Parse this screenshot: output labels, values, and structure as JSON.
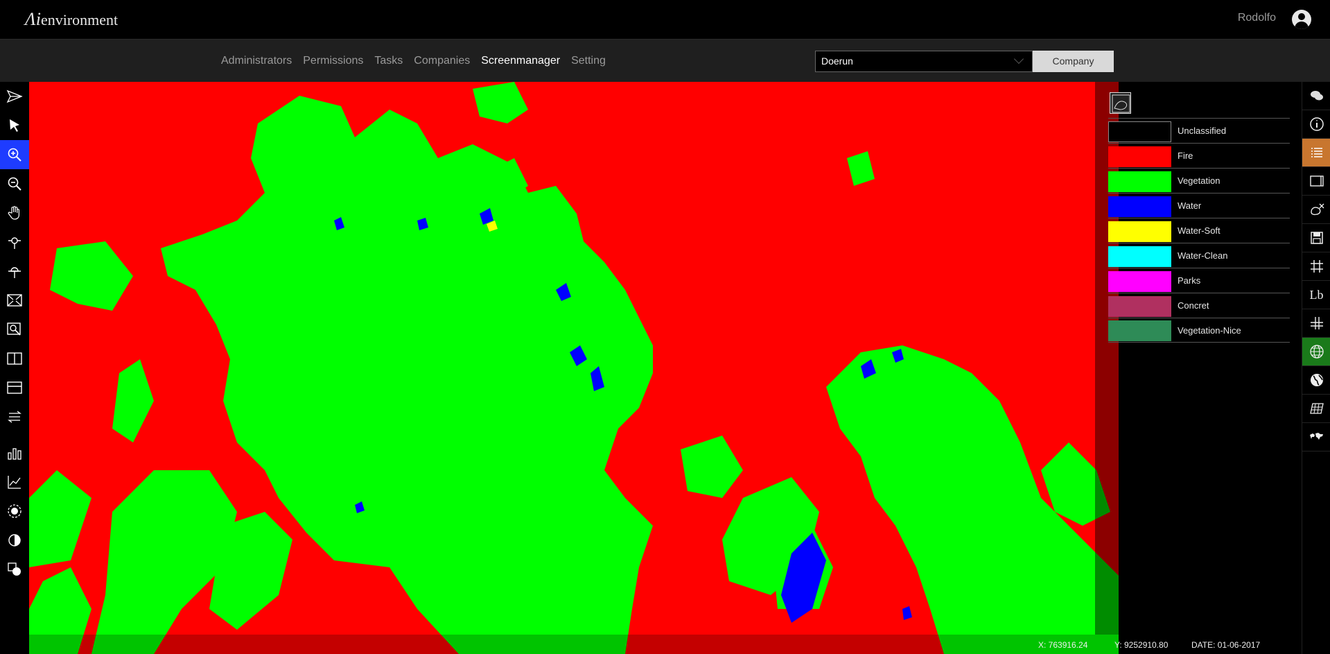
{
  "header": {
    "logo_ai": "Λi",
    "logo_text": "environment",
    "user_name": "Rodolfo"
  },
  "nav": {
    "items": [
      "Administrators",
      "Permissions",
      "Tasks",
      "Companies",
      "Screenmanager",
      "Setting"
    ],
    "active": "Screenmanager"
  },
  "company": {
    "selected": "Doerun",
    "button_label": "Company"
  },
  "left_toolbar": [
    {
      "name": "send-icon"
    },
    {
      "name": "pointer-icon"
    },
    {
      "name": "zoom-in-icon",
      "active": true
    },
    {
      "name": "zoom-out-icon"
    },
    {
      "name": "pan-hand-icon"
    },
    {
      "name": "pin-add-icon"
    },
    {
      "name": "pin-remove-icon"
    },
    {
      "name": "fit-extent-icon"
    },
    {
      "name": "zoom-window-icon"
    },
    {
      "name": "split-vertical-icon"
    },
    {
      "name": "split-horizontal-icon"
    },
    {
      "name": "swipe-icon"
    },
    {
      "name": "bar-chart-icon"
    },
    {
      "name": "line-chart-icon"
    },
    {
      "name": "brightness-icon"
    },
    {
      "name": "contrast-icon"
    },
    {
      "name": "layers-color-icon"
    }
  ],
  "right_toolbar": [
    {
      "name": "chat-icon"
    },
    {
      "name": "info-icon"
    },
    {
      "name": "legend-list-icon",
      "state": "orange"
    },
    {
      "name": "panel-icon"
    },
    {
      "name": "clear-layer-icon"
    },
    {
      "name": "save-icon"
    },
    {
      "name": "grid-icon"
    },
    {
      "name": "label-icon",
      "text": "Lb"
    },
    {
      "name": "graticule-icon"
    },
    {
      "name": "globe-grid-icon",
      "state": "green"
    },
    {
      "name": "globe-icon"
    },
    {
      "name": "map-tiles-icon"
    },
    {
      "name": "world-map-icon"
    }
  ],
  "legend": [
    {
      "label": "Unclassified",
      "color": "#000000"
    },
    {
      "label": "Fire",
      "color": "#ff0000"
    },
    {
      "label": "Vegetation",
      "color": "#00ff00"
    },
    {
      "label": "Water",
      "color": "#0000ff"
    },
    {
      "label": "Water-Soft",
      "color": "#ffff00"
    },
    {
      "label": "Water-Clean",
      "color": "#00ffff"
    },
    {
      "label": "Parks",
      "color": "#ff00ff"
    },
    {
      "label": "Concret",
      "color": "#b03060"
    },
    {
      "label": "Vegetation-Nice",
      "color": "#2e8b57"
    }
  ],
  "status": {
    "x": "X: 763916.24",
    "y": "Y: 9252910.80",
    "date": "DATE: 01-06-2017"
  }
}
